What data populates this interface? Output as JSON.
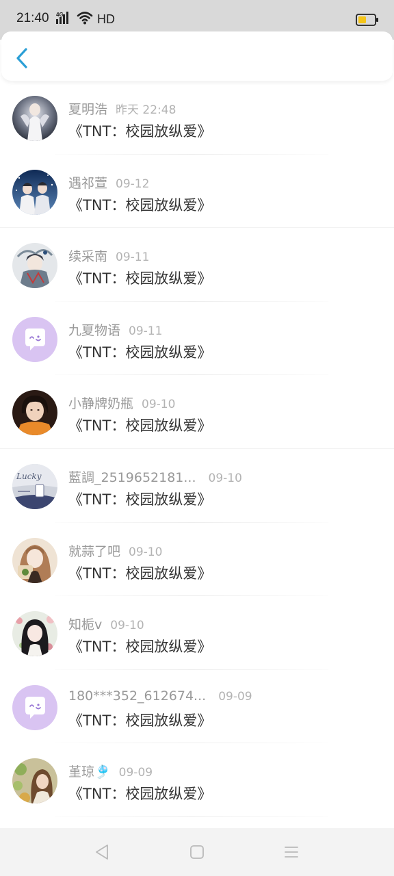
{
  "status_bar": {
    "time": "21:40",
    "network": "4G",
    "hd_label": "HD",
    "battery_color": "#f5c518"
  },
  "header": {
    "back_icon": "chevron-left-icon",
    "accent_color": "#2b9fd6"
  },
  "messages": [
    {
      "name": "夏明浩",
      "time": "昨天 22:48",
      "title": "《TNT：校园放纵爱》",
      "avatar": "photo"
    },
    {
      "name": "遇祁萱",
      "time": "09-12",
      "title": "《TNT：校园放纵爱》",
      "avatar": "photo"
    },
    {
      "name": "续采南",
      "time": "09-11",
      "title": "《TNT：校园放纵爱》",
      "avatar": "photo"
    },
    {
      "name": "九夏物语",
      "time": "09-11",
      "title": "《TNT：校园放纵爱》",
      "avatar": "default-chat-icon"
    },
    {
      "name": "小静牌奶瓶",
      "time": "09-10",
      "title": "《TNT：校园放纵爱》",
      "avatar": "photo"
    },
    {
      "name": "藍調_2519652181...",
      "time": "09-10",
      "title": "《TNT：校园放纵爱》",
      "avatar": "photo"
    },
    {
      "name": "就蒜了吧",
      "time": "09-10",
      "title": "《TNT：校园放纵爱》",
      "avatar": "photo"
    },
    {
      "name": "知栀v",
      "time": "09-10",
      "title": "《TNT：校园放纵爱》",
      "avatar": "photo"
    },
    {
      "name": "180***352_612674...",
      "time": "09-09",
      "title": "《TNT：校园放纵爱》",
      "avatar": "default-chat-icon"
    },
    {
      "name": "堇琼🎐",
      "time": "09-09",
      "title": "《TNT：校园放纵爱》",
      "avatar": "photo"
    }
  ],
  "nav_bar": {
    "back": "triangle-back-icon",
    "home": "square-home-icon",
    "menu": "menu-lines-icon"
  }
}
